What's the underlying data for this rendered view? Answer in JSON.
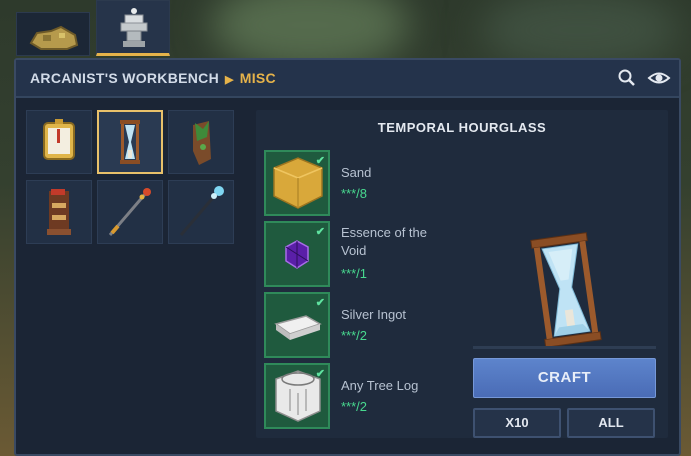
{
  "header": {
    "bench": "ARCANIST'S WORKBENCH",
    "category": "MISC"
  },
  "recipes": [
    {
      "name": "compass-item-icon"
    },
    {
      "name": "hourglass-item-icon",
      "selected": true
    },
    {
      "name": "vine-totem-item-icon"
    },
    {
      "name": "tiki-totem-item-icon"
    },
    {
      "name": "fire-staff-item-icon"
    },
    {
      "name": "ice-staff-item-icon"
    }
  ],
  "detail": {
    "title": "TEMPORAL HOURGLASS",
    "ingredients": [
      {
        "name": "Sand",
        "qty": "***/8",
        "icon": "sand-block-icon",
        "color": "#d9a83a"
      },
      {
        "name": "Essence of the Void",
        "qty": "***/1",
        "icon": "void-crystal-icon",
        "color": "#7a2fd0"
      },
      {
        "name": "Silver Ingot",
        "qty": "***/2",
        "icon": "silver-ingot-icon",
        "color": "#d8d8d8"
      },
      {
        "name": "Any Tree Log",
        "qty": "***/2",
        "icon": "tree-log-icon",
        "color": "#e8e8e8"
      }
    ],
    "craft_label": "CRAFT",
    "x10_label": "X10",
    "all_label": "ALL"
  },
  "colors": {
    "accent": "#e6b34a",
    "qty_green": "#48d98f",
    "craft_blue": "#5577c2"
  }
}
